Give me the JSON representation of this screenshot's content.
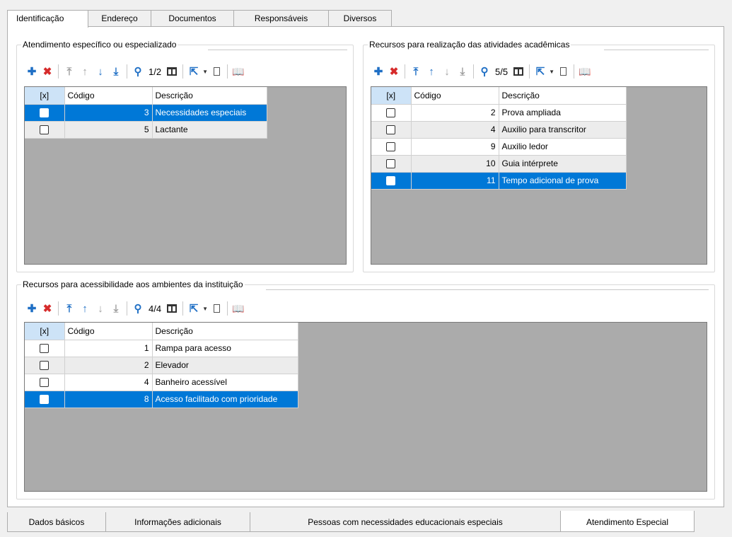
{
  "top_tabs": [
    "Identificação",
    "Endereço",
    "Documentos",
    "Responsáveis",
    "Diversos"
  ],
  "bottom_tabs": [
    "Dados básicos",
    "Informações adicionais",
    "Pessoas com necessidades educacionais especiais",
    "Atendimento Especial"
  ],
  "headers": {
    "check": "[x]",
    "code": "Código",
    "desc": "Descrição"
  },
  "group1": {
    "title": "Atendimento específico ou especializado",
    "page": "1/2",
    "rows": [
      {
        "code": "3",
        "desc": "Necessidades especiais"
      },
      {
        "code": "5",
        "desc": "Lactante"
      }
    ]
  },
  "group2": {
    "title": "Recursos para realização das atividades acadêmicas",
    "page": "5/5",
    "rows": [
      {
        "code": "2",
        "desc": "Prova ampliada"
      },
      {
        "code": "4",
        "desc": "Auxilio para transcritor"
      },
      {
        "code": "9",
        "desc": "Auxilio ledor"
      },
      {
        "code": "10",
        "desc": "Guia intérprete"
      },
      {
        "code": "11",
        "desc": "Tempo adicional de prova"
      }
    ]
  },
  "group3": {
    "title": "Recursos para acessibilidade aos ambientes da instituição",
    "page": "4/4",
    "rows": [
      {
        "code": "1",
        "desc": "Rampa para acesso"
      },
      {
        "code": "2",
        "desc": "Elevador"
      },
      {
        "code": "4",
        "desc": "Banheiro acessível"
      },
      {
        "code": "8",
        "desc": "Acesso facilitado com prioridade"
      }
    ]
  },
  "icons": [
    "add-icon",
    "delete-icon",
    "move-top-icon",
    "move-up-icon",
    "move-down-icon",
    "move-bottom-icon",
    "search-icon",
    "columns-icon",
    "export-icon",
    "dropdown-icon",
    "document-icon",
    "book-icon"
  ]
}
